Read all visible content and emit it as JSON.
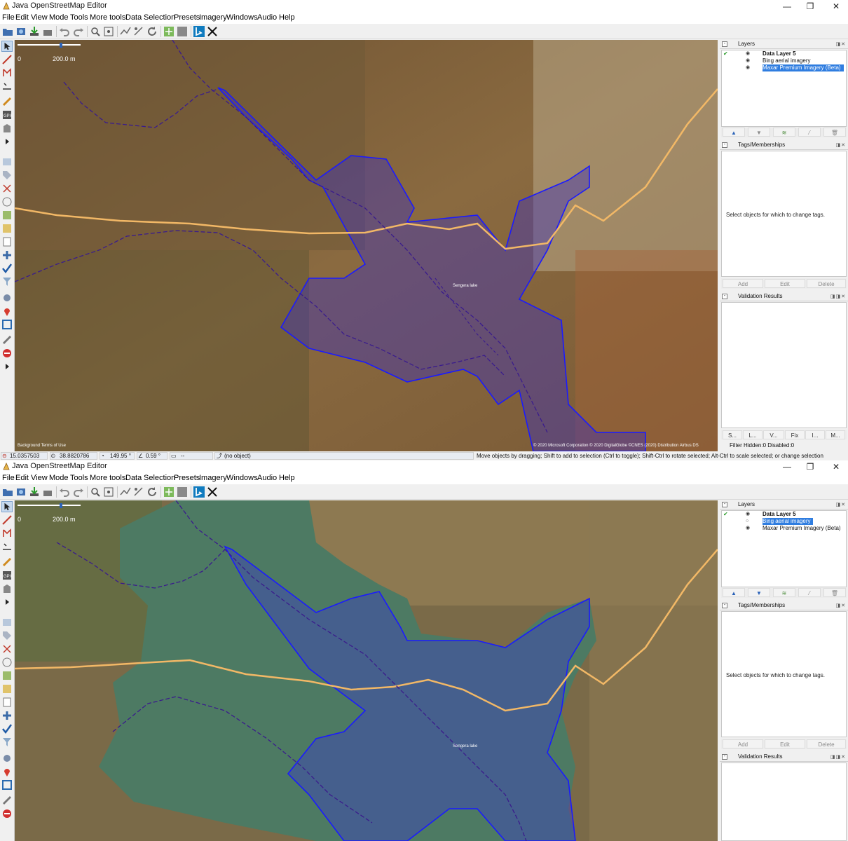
{
  "title": "Java OpenStreetMap Editor",
  "window_controls": {
    "minimize": "—",
    "maximize": "❐",
    "close": "✕"
  },
  "menu": [
    "File",
    "Edit",
    "View",
    "Mode",
    "Tools",
    "More tools",
    "Data",
    "Selection",
    "Presets",
    "Imagery",
    "Windows",
    "Audio",
    "Help"
  ],
  "scale": {
    "zero": "0",
    "label": "200.0 m"
  },
  "lake_label": "Sengera lake",
  "attribution": {
    "left": "Background Terms of Use",
    "right": "© 2020 Microsoft Corporation © 2020 DigitalGlobe ©CNES (2020) Distribution Airbus DS"
  },
  "layers_panel": {
    "title": "Layers",
    "top_layers": [
      {
        "name": "Data Layer 5",
        "bold": true,
        "selected": false
      },
      {
        "name": "Bing aerial imagery",
        "bold": false,
        "selected": false
      },
      {
        "name": "Maxar Premium Imagery (Beta)",
        "bold": false,
        "selected": true
      }
    ],
    "bottom_layers": [
      {
        "name": "Data Layer 5",
        "bold": true,
        "selected": false
      },
      {
        "name": "Bing aerial imagery",
        "bold": false,
        "selected": true
      },
      {
        "name": "Maxar Premium Imagery (Beta)",
        "bold": false,
        "selected": false
      }
    ]
  },
  "tags_panel": {
    "title": "Tags/Memberships",
    "message": "Select objects for which to change tags.",
    "add": "Add",
    "edit": "Edit",
    "delete": "Delete"
  },
  "validation_panel": {
    "title": "Validation Results"
  },
  "bottom_tabs": [
    "S...",
    "L...",
    "V...",
    "Fix",
    "I...",
    "M..."
  ],
  "filter_text": "Filter Hidden:0 Disabled:0",
  "status": {
    "lat": "15.0357503",
    "lon": "38.8820786",
    "heading": "149.95 °",
    "angle": "0.59 °",
    "length": "--",
    "object": "(no object)",
    "hint": "Move objects by dragging; Shift to add to selection (Ctrl to toggle); Shift-Ctrl to rotate selected; Alt-Ctrl to scale selected; or change selection"
  },
  "colors": {
    "selection_blue": "#2f7de0",
    "outline": "#1a1aff",
    "road": "#f2b866",
    "waterway": "#3a1c8c",
    "lake_water": "#4d7a63",
    "terrain_top": "#8a6a3e"
  }
}
